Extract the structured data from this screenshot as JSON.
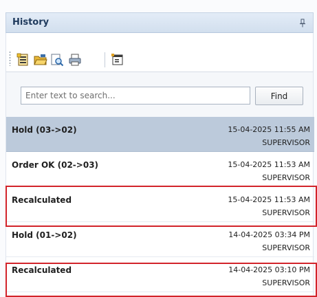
{
  "panel": {
    "title": "History"
  },
  "toolbar": {
    "buttons": [
      {
        "icon": "new-document-icon"
      },
      {
        "icon": "open-folder-icon"
      },
      {
        "icon": "print-preview-icon"
      },
      {
        "icon": "printer-icon"
      },
      {
        "icon": "properties-icon"
      }
    ]
  },
  "search": {
    "placeholder": "Enter text to search...",
    "value": "",
    "find_label": "Find"
  },
  "history": {
    "items": [
      {
        "title": "Hold (03->02)",
        "timestamp": "15-04-2025 11:55 AM",
        "user": "SUPERVISOR",
        "selected": true,
        "highlighted": false
      },
      {
        "title": "Order OK (02->03)",
        "timestamp": "15-04-2025 11:53 AM",
        "user": "SUPERVISOR",
        "selected": false,
        "highlighted": false
      },
      {
        "title": "Recalculated",
        "timestamp": "15-04-2025 11:53 AM",
        "user": "SUPERVISOR",
        "selected": false,
        "highlighted": true
      },
      {
        "title": "Hold (01->02)",
        "timestamp": "14-04-2025 03:34 PM",
        "user": "SUPERVISOR",
        "selected": false,
        "highlighted": false
      },
      {
        "title": "Recalculated",
        "timestamp": "14-04-2025 03:10 PM",
        "user": "SUPERVISOR",
        "selected": false,
        "highlighted": true
      }
    ]
  },
  "colors": {
    "selected_row": "#bccadb",
    "highlight_border": "#d2232a",
    "title_text": "#1f3a5d"
  }
}
